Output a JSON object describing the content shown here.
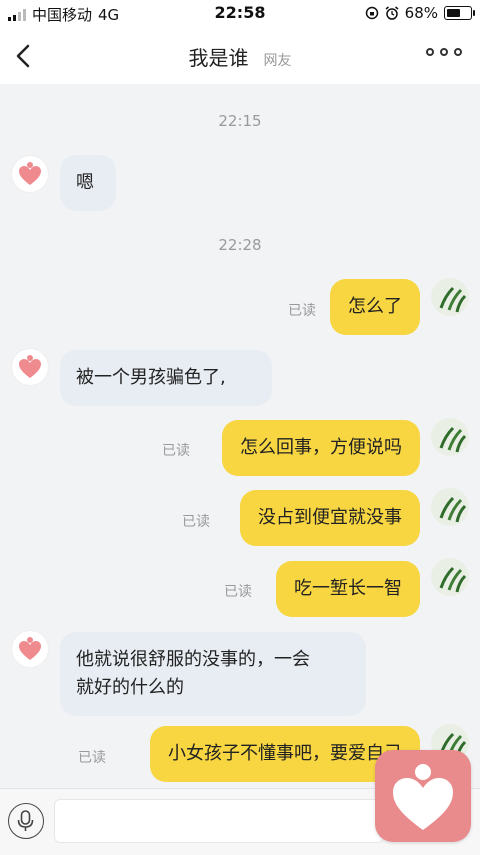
{
  "status_bar": {
    "carrier": "中国移动",
    "network": "4G",
    "time": "22:58",
    "battery_percent": "68%",
    "battery_level": 0.68
  },
  "header": {
    "title": "我是谁",
    "subtitle": "网友"
  },
  "messages": {
    "ts1": "22:15",
    "m1": "嗯",
    "ts2": "22:28",
    "m2": "怎么了",
    "m2_read": "已读",
    "m3": "被一个男孩骗色了,",
    "m4": "怎么回事，方便说吗",
    "m4_read": "已读",
    "m5": "没占到便宜就没事",
    "m5_read": "已读",
    "m6": "吃一堑长一智",
    "m6_read": "已读",
    "m7_line1": "他就说很舒服的没事的，一会",
    "m7_line2": "就好的什么的",
    "m8": "小女孩子不懂事吧，要爱自己",
    "m8_read": "已读"
  },
  "colors": {
    "self_bubble": "#f7d642",
    "other_bubble": "#e8edf3",
    "logo": "#e98a8d",
    "avatar_heart": "#ef8a8f"
  },
  "icons": {
    "back": "chevron-left-icon",
    "more": "more-dots-icon",
    "mic": "microphone-icon",
    "avatar_other": "heart-avatar-icon",
    "avatar_self": "plant-avatar-icon",
    "logo": "heart-logo-icon"
  }
}
